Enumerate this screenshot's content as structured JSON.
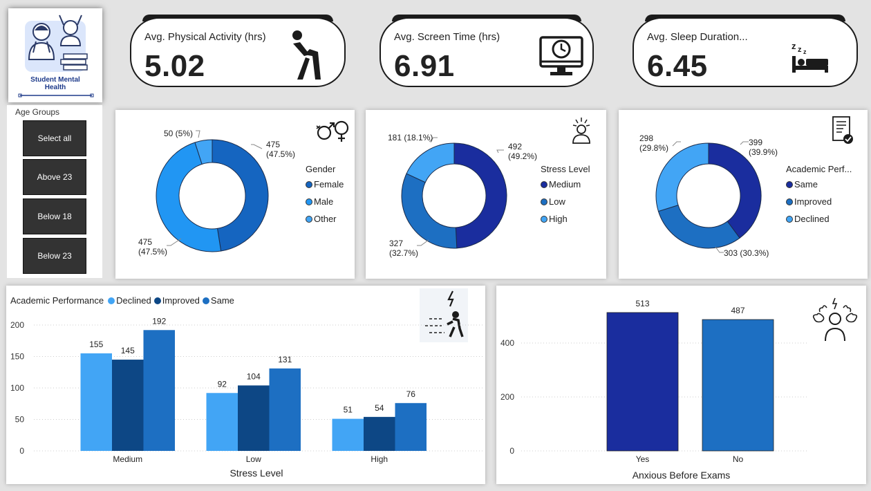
{
  "logo": {
    "title_line1": "Student Mental",
    "title_line2": "Health"
  },
  "slicer": {
    "title": "Age Groups",
    "options": [
      "Select all",
      "Above 23",
      "Below 18",
      "Below 23"
    ]
  },
  "kpis": [
    {
      "label": "Avg. Physical Activity (hrs)",
      "value": "5.02",
      "icon": "exercise-icon"
    },
    {
      "label": "Avg. Screen Time (hrs)",
      "value": "6.91",
      "icon": "monitor-clock-icon"
    },
    {
      "label": "Avg. Sleep Duration...",
      "value": "6.45",
      "icon": "sleep-bed-icon"
    }
  ],
  "donuts": {
    "gender": {
      "legend_title": "Gender",
      "items": [
        "Female",
        "Male",
        "Other"
      ],
      "labels": {
        "female": "475\n(47.5%)",
        "male": "475\n(47.5%)",
        "other": "50 (5%)"
      }
    },
    "stress": {
      "legend_title": "Stress Level",
      "items": [
        "Medium",
        "Low",
        "High"
      ],
      "labels": {
        "medium": "492\n(49.2%)",
        "low": "327\n(32.7%)",
        "high": "181 (18.1%)"
      }
    },
    "academic": {
      "legend_title": "Academic Perf...",
      "items": [
        "Same",
        "Improved",
        "Declined"
      ],
      "labels": {
        "same": "399\n(39.9%)",
        "improved": "303 (30.3%)",
        "declined": "298\n(29.8%)"
      }
    }
  },
  "colors": {
    "light": "#42a5f5",
    "dark": "#0d4785",
    "mid": "#1d6fc2",
    "navy": "#1a2d9e",
    "female": "#1565c0",
    "male": "#2196f3",
    "other": "#42a5f5"
  },
  "chart_data": [
    {
      "type": "pie",
      "legend_title": "Gender",
      "categories": [
        "Female",
        "Male",
        "Other"
      ],
      "values": [
        475,
        475,
        50
      ],
      "percent": [
        47.5,
        47.5,
        5
      ]
    },
    {
      "type": "pie",
      "legend_title": "Stress Level",
      "categories": [
        "Medium",
        "Low",
        "High"
      ],
      "values": [
        492,
        327,
        181
      ],
      "percent": [
        49.2,
        32.7,
        18.1
      ]
    },
    {
      "type": "pie",
      "legend_title": "Academic Perf...",
      "categories": [
        "Same",
        "Improved",
        "Declined"
      ],
      "values": [
        399,
        303,
        298
      ],
      "percent": [
        39.9,
        30.3,
        29.8
      ]
    },
    {
      "type": "bar",
      "legend_title": "Academic Performance",
      "categories": [
        "Medium",
        "Low",
        "High"
      ],
      "series": [
        {
          "name": "Declined",
          "values": [
            155,
            92,
            51
          ]
        },
        {
          "name": "Improved",
          "values": [
            145,
            104,
            54
          ]
        },
        {
          "name": "Same",
          "values": [
            192,
            131,
            76
          ]
        }
      ],
      "xlabel": "Stress Level",
      "ylabel": "",
      "yticks": [
        0,
        50,
        100,
        150,
        200
      ],
      "ylim": [
        0,
        200
      ],
      "grid": true,
      "legend_position": "top-left"
    },
    {
      "type": "bar",
      "categories": [
        "Yes",
        "No"
      ],
      "values": [
        513,
        487
      ],
      "xlabel": "Anxious Before Exams",
      "ylabel": "",
      "yticks": [
        0,
        200,
        400
      ],
      "ylim": [
        0,
        530
      ],
      "grid": true
    }
  ]
}
